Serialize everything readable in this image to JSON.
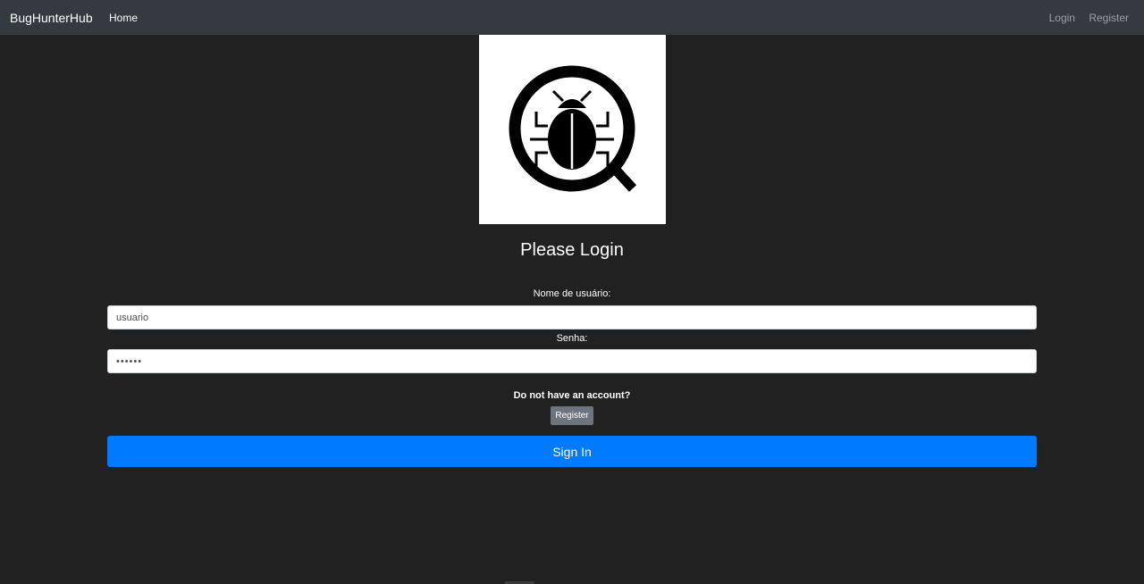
{
  "navbar": {
    "brand": "BugHunterHub",
    "home": "Home",
    "login": "Login",
    "register": "Register"
  },
  "logo": {
    "icon": "bug-magnifier-icon"
  },
  "form": {
    "title": "Please Login",
    "username_label": "Nome de usuário:",
    "username_value": "usuario",
    "password_label": "Senha:",
    "password_value": "••••••",
    "no_account_prompt": "Do not have an account?",
    "register_button": "Register",
    "signin_button": "Sign In"
  },
  "colors": {
    "navbar_bg": "#343a40",
    "page_bg": "#212121",
    "primary": "#007bff",
    "secondary": "#6c757d"
  }
}
